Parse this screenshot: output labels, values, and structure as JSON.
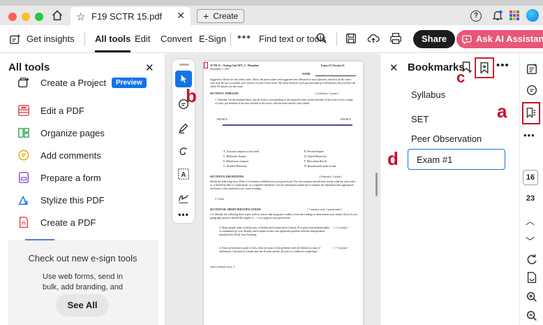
{
  "titlebar": {
    "doc_tab": "F19 SCTR 15.pdf",
    "create_tab": "Create"
  },
  "toolbar": {
    "get_insights": "Get insights",
    "all_tools": "All tools",
    "edit": "Edit",
    "convert": "Convert",
    "esign": "E-Sign",
    "find": "Find text or tools",
    "share": "Share",
    "ai_assistant": "Ask AI Assistant"
  },
  "left_panel": {
    "title": "All tools",
    "tools": [
      {
        "label": "Create a Project",
        "icon": "create-project-icon",
        "badge": "Preview"
      },
      {
        "label": "Edit a PDF",
        "icon": "edit-pdf-icon"
      },
      {
        "label": "Organize pages",
        "icon": "organize-pages-icon"
      },
      {
        "label": "Add comments",
        "icon": "comment-icon"
      },
      {
        "label": "Prepare a form",
        "icon": "form-icon"
      },
      {
        "label": "Stylize this PDF",
        "icon": "stylize-icon"
      },
      {
        "label": "Create a PDF",
        "icon": "create-pdf-icon"
      }
    ],
    "promo_title": "Check out new e-sign tools",
    "promo_body": "Use web forms, send in bulk, add branding, and more.",
    "see_all": "See All"
  },
  "document": {
    "header_left_1": "SCTR 15 ~ Testing Unit 2071, C. Wineplatz",
    "header_left_2": "November 1, 2017",
    "header_right": "Exam #1 (Version A)",
    "name_label": "NAME",
    "suggestion": "Suggestion: Read over the whole exam. Notice the point values and suggested time allocated to each question, and then do the easier ones first. Be sure to number your answers in your Green book. The times listed for each question add up to 60 minutes, but you have the whole 65 minutes for the exam.",
    "section1": "SECTION I. TIMELINE",
    "section1_pts": "[ 6 minutes, ½ point ]",
    "q1": "1. Timeline. On the timeline below, put the letters corresponding to the required events on the timeline. If the event covers a range of years, put brackets at the start and end of the event, with the letter and the years inside.",
    "tl_left": "1000 BCE",
    "tl_right": "1000 BCE",
    "events_left": [
      "A. Assyrian conquest of the north",
      "C. Hellenistic Empire",
      "E. Babylonian conquest",
      "G. Divided Monarchy"
    ],
    "events_right": [
      "B. Persian Empire",
      "D. United Monarchy",
      "F. Maccabean Revolt",
      "H. Reunification under Josiah"
    ],
    "section2": "SECTION II. DEFINITIONS",
    "section2_pts": "[ 8 minutes, ⅔ point ]",
    "def_text": "Define the following term. Write a 3-4 sentence definition in your green book. The first sentence should state clearly what the term refers to; it should be able to \"stand alone\" as a complete definition. Use the subsequent sentence(s) to amplify the definition with appropriate references to the material in our course readings.",
    "def_term": "2. Torah",
    "section3": "SECTION III. SHORT IDENTIFICATIONS",
    "section3_pts": "[ 7 minutes each, 3 points total ]",
    "q34": "3-4. Identify the following three topics with an answer that integrates evidence from the readings to demonstrate your claims. Each of your paragraphs answers should fill roughly ¾ – ⅓ of a page in your green book.",
    "q3": "3. Many people today read the story of Sodom and Gomorrah in Genesis 19 as proof that homosexuality is condemned by God. Identify and evaluate at least one significant problem with this interpretation introduced by Holly Joan Toensing.",
    "q3_pts": "[ 1 ½ points ]",
    "q4": "4. From an historian's point of view, what are some of the problems with the biblical account of settlement of the land of Canaan after the Exodus and the 40 years of wilderness wandering?",
    "q4_pts": "[ 1 ½ points ]",
    "footer": "exam continues on p. 2",
    "annotation_b": "b"
  },
  "bookmarks": {
    "title": "Bookmarks",
    "items": [
      "Syllabus",
      "SET",
      "Peer Observation"
    ],
    "selected": "Exam #1",
    "annotation_c": "c",
    "annotation_d": "d"
  },
  "rail": {
    "annotation_a": "a",
    "current_page": "16",
    "total_pages": "23"
  },
  "colors": {
    "accent": "#1473e6",
    "ai_pink": "#e8567a",
    "annotation_red": "#c8102e"
  }
}
